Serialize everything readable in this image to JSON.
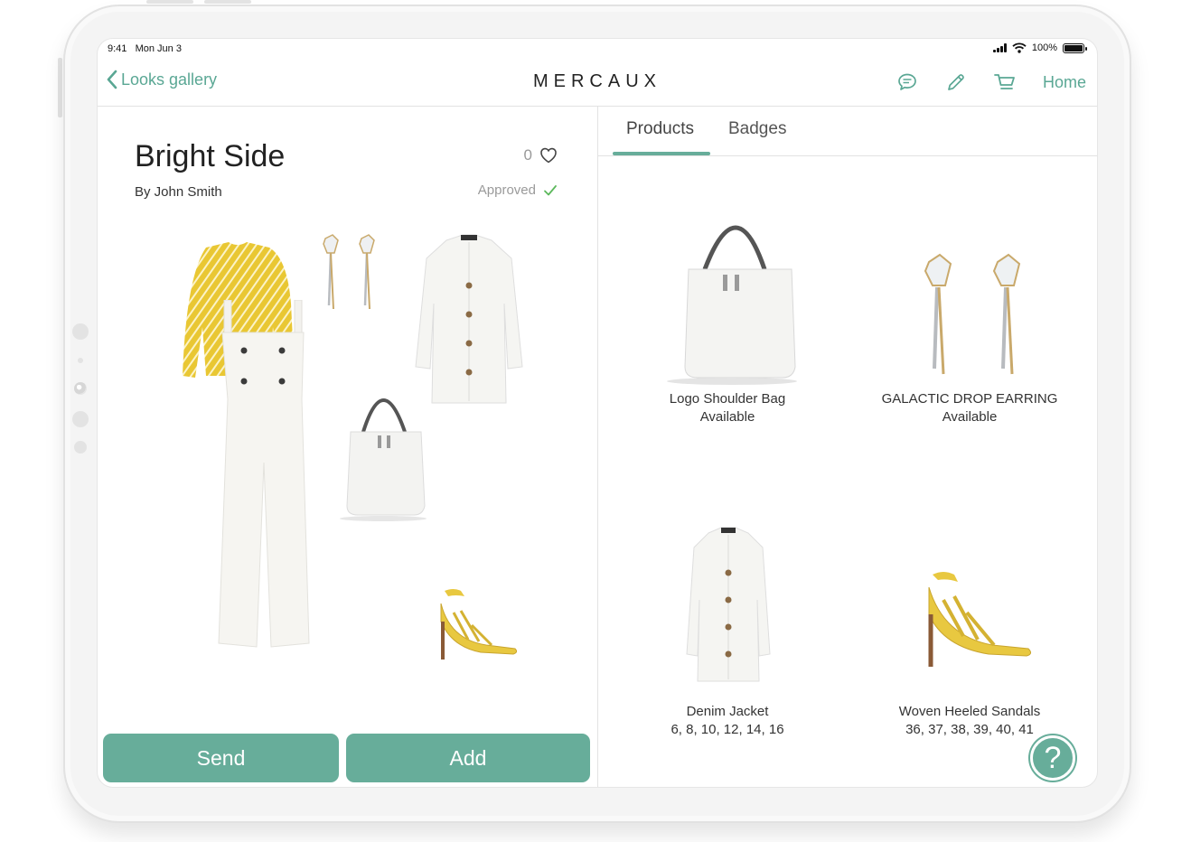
{
  "status_bar": {
    "time": "9:41",
    "date": "Mon Jun 3",
    "battery": "100%"
  },
  "navbar": {
    "back_label": "Looks gallery",
    "brand": "MERCAUX",
    "home_label": "Home"
  },
  "look": {
    "title": "Bright Side",
    "author": "By John Smith",
    "likes": "0",
    "status": "Approved"
  },
  "actions": {
    "send_label": "Send",
    "add_label": "Add"
  },
  "tabs": [
    {
      "label": "Products",
      "active": true
    },
    {
      "label": "Badges",
      "active": false
    }
  ],
  "products": [
    {
      "name": "Logo Shoulder Bag",
      "detail": "Available"
    },
    {
      "name": "GALACTIC DROP EARRING",
      "detail": "Available"
    },
    {
      "name": "Denim Jacket",
      "detail": "6, 8, 10, 12, 14, 16"
    },
    {
      "name": "Woven Heeled Sandals",
      "detail": "36, 37, 38, 39, 40, 41"
    }
  ],
  "help_label": "?",
  "colors": {
    "accent": "#67ad9a",
    "link": "#5aa794",
    "approved_check": "#5cb85c"
  }
}
